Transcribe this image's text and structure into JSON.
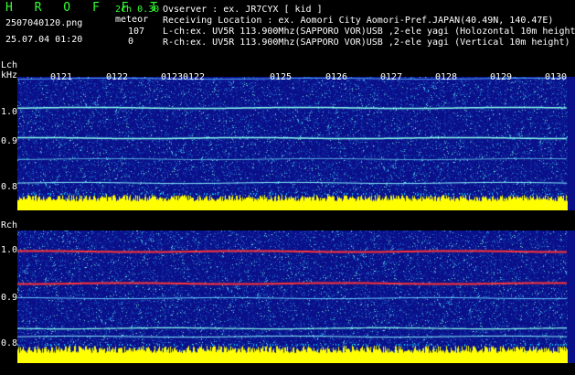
{
  "header": {
    "app_title": "H R O F F T",
    "filename": "2507040120.png",
    "timestamp": "25.07.04 01:20",
    "mode": "2ch 0.30",
    "meteor_label": "meteor",
    "meteor_l": "107",
    "meteor_r": "0",
    "observer": "Ovserver              : ex. JR7CYX [ kid ]",
    "location": "Receiving Location : ex. Aomori City Aomori-Pref.JAPAN(40.49N, 140.47E)",
    "lch": "L-ch:ex. UV5R 113.900Mhz(SAPPORO VOR)USB ,2-ele yagi (Holozontal 10m height)",
    "rch": "R-ch:ex. UV5R 113.900Mhz(SAPPORO VOR)USB ,2-ele yagi (Vertical 10m height)"
  },
  "left_panel": {
    "name": "Lch",
    "unit": "kHz",
    "ticks": [
      "1.0",
      "0.9",
      "0.8"
    ],
    "time_labels": [
      "0121",
      "0122",
      "0123",
      "0122",
      "0125",
      "0126",
      "0127",
      "0128",
      "0129",
      "0130"
    ]
  },
  "right_panel": {
    "name": "Rch",
    "ticks": [
      "1.0",
      "0.9",
      "0.8"
    ]
  },
  "colors": {
    "background": "#0a0f8a",
    "trace_l": "#8fe",
    "trace_r": "#f33",
    "noise_floor": "#ff0"
  }
}
